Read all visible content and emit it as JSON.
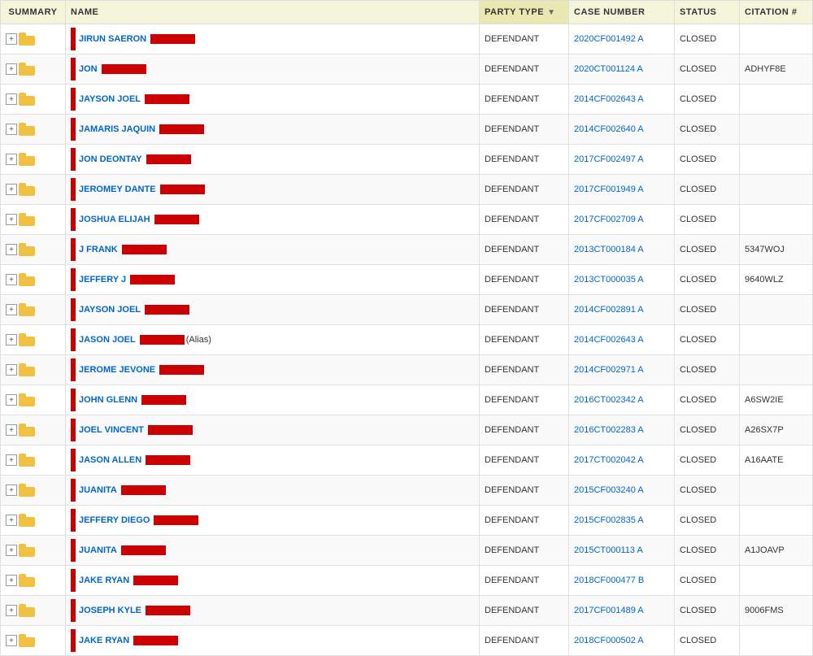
{
  "headers": {
    "summary": "SUMMARY",
    "name": "NAME",
    "party_type": "PARTY TYPE",
    "case_number": "CASE NUMBER",
    "status": "STATUS",
    "citation": "CITATION #"
  },
  "rows": [
    {
      "first_name": "JIRUN SAERON",
      "party_type": "DEFENDANT",
      "case_number": "2020CF001492 A",
      "status": "CLOSED",
      "citation": ""
    },
    {
      "first_name": "JON",
      "party_type": "DEFENDANT",
      "case_number": "2020CT001124 A",
      "status": "CLOSED",
      "citation": "ADHYF8E"
    },
    {
      "first_name": "JAYSON JOEL",
      "party_type": "DEFENDANT",
      "case_number": "2014CF002643 A",
      "status": "CLOSED",
      "citation": ""
    },
    {
      "first_name": "JAMARIS JAQUIN",
      "party_type": "DEFENDANT",
      "case_number": "2014CF002640 A",
      "status": "CLOSED",
      "citation": ""
    },
    {
      "first_name": "JON DEONTAY",
      "party_type": "DEFENDANT",
      "case_number": "2017CF002497 A",
      "status": "CLOSED",
      "citation": ""
    },
    {
      "first_name": "JEROMEY DANTE",
      "party_type": "DEFENDANT",
      "case_number": "2017CF001949 A",
      "status": "CLOSED",
      "citation": ""
    },
    {
      "first_name": "JOSHUA ELIJAH",
      "party_type": "DEFENDANT",
      "case_number": "2017CF002709 A",
      "status": "CLOSED",
      "citation": ""
    },
    {
      "first_name": "J FRANK",
      "party_type": "DEFENDANT",
      "case_number": "2013CT000184 A",
      "status": "CLOSED",
      "citation": "5347WOJ"
    },
    {
      "first_name": "JEFFERY J",
      "party_type": "DEFENDANT",
      "case_number": "2013CT000035 A",
      "status": "CLOSED",
      "citation": "9640WLZ"
    },
    {
      "first_name": "JAYSON JOEL",
      "party_type": "DEFENDANT",
      "case_number": "2014CF002891 A",
      "status": "CLOSED",
      "citation": ""
    },
    {
      "first_name": "JASON JOEL",
      "alias": true,
      "party_type": "DEFENDANT",
      "case_number": "2014CF002643 A",
      "status": "CLOSED",
      "citation": ""
    },
    {
      "first_name": "JEROME JEVONE",
      "party_type": "DEFENDANT",
      "case_number": "2014CF002971 A",
      "status": "CLOSED",
      "citation": ""
    },
    {
      "first_name": "JOHN GLENN",
      "party_type": "DEFENDANT",
      "case_number": "2016CT002342 A",
      "status": "CLOSED",
      "citation": "A6SW2IE"
    },
    {
      "first_name": "JOEL VINCENT",
      "party_type": "DEFENDANT",
      "case_number": "2016CT002283 A",
      "status": "CLOSED",
      "citation": "A26SX7P"
    },
    {
      "first_name": "JASON ALLEN",
      "party_type": "DEFENDANT",
      "case_number": "2017CT002042 A",
      "status": "CLOSED",
      "citation": "A16AATE"
    },
    {
      "first_name": "JUANITA",
      "party_type": "DEFENDANT",
      "case_number": "2015CF003240 A",
      "status": "CLOSED",
      "citation": ""
    },
    {
      "first_name": "JEFFERY DIEGO",
      "party_type": "DEFENDANT",
      "case_number": "2015CF002835 A",
      "status": "CLOSED",
      "citation": ""
    },
    {
      "first_name": "JUANITA",
      "party_type": "DEFENDANT",
      "case_number": "2015CT000113 A",
      "status": "CLOSED",
      "citation": "A1JOAVP"
    },
    {
      "first_name": "JAKE RYAN",
      "party_type": "DEFENDANT",
      "case_number": "2018CF000477 B",
      "status": "CLOSED",
      "citation": ""
    },
    {
      "first_name": "JOSEPH KYLE",
      "party_type": "DEFENDANT",
      "case_number": "2017CF001489 A",
      "status": "CLOSED",
      "citation": "9006FMS"
    },
    {
      "first_name": "JAKE RYAN",
      "party_type": "DEFENDANT",
      "case_number": "2018CF000502 A",
      "status": "CLOSED",
      "citation": ""
    }
  ]
}
